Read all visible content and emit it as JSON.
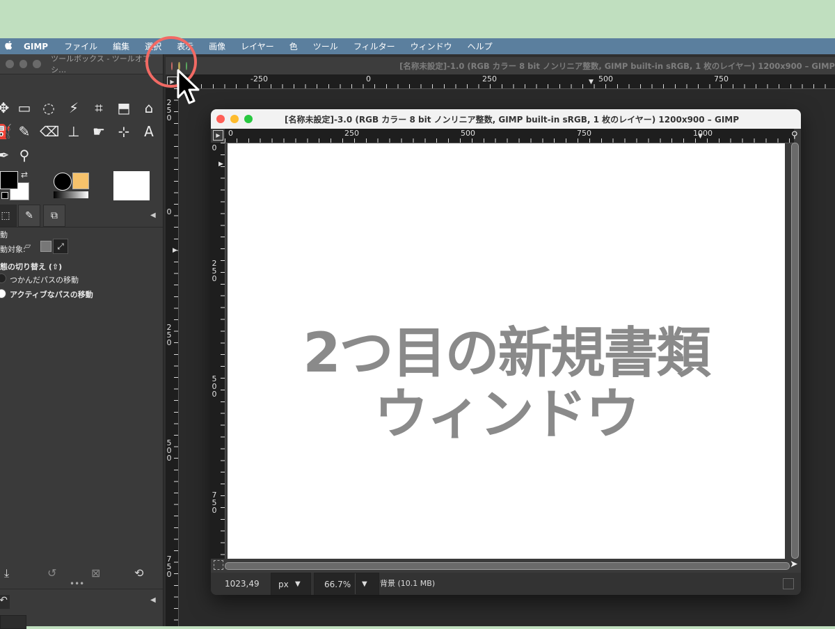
{
  "menubar": {
    "apple": "",
    "app": "GIMP",
    "items": [
      "ファイル",
      "編集",
      "選択",
      "表示",
      "画像",
      "レイヤー",
      "色",
      "ツール",
      "フィルター",
      "ウィンドウ",
      "ヘルプ"
    ]
  },
  "toolbox": {
    "title": "ツールボックス - ツールオプシ…",
    "options": {
      "heading": "動",
      "target_label": "動対象:",
      "toggle_label": "態の切り替え (⇧)",
      "radio1": "つかんだパスの移動",
      "radio2": "アクティブなパスの移動"
    }
  },
  "back_window": {
    "title": "[名称未設定]-1.0 (RGB カラー 8 bit ノンリニア整数, GIMP built-in sRGB, 1 枚のレイヤー) 1200x900 – GIMP",
    "ruler_h": [
      "-250",
      "0",
      "250",
      "500",
      "750"
    ],
    "ruler_v": [
      [
        "2",
        "5",
        "0"
      ],
      [
        "0"
      ],
      [
        "2",
        "5",
        "0"
      ],
      [
        "5",
        "0",
        "0"
      ],
      [
        "7",
        "5",
        "0"
      ]
    ]
  },
  "front_window": {
    "title": "[名称未設定]-3.0 (RGB カラー 8 bit ノンリニア整数, GIMP built-in sRGB, 1 枚のレイヤー) 1200x900 – GIMP",
    "ruler_h": [
      "0",
      "250",
      "500",
      "750",
      "1000"
    ],
    "ruler_v": [
      [
        "0"
      ],
      [
        "2",
        "5",
        "0"
      ],
      [
        "5",
        "0",
        "0"
      ],
      [
        "7",
        "5",
        "0"
      ]
    ],
    "canvas_text_line1": "2つ目の新規書類",
    "canvas_text_line2": "ウィンドウ",
    "status": {
      "coords": "1023,49",
      "unit": "px",
      "zoom": "66.7%",
      "info": "背景 (10.1 MB)"
    }
  },
  "colors": {
    "menubar": "#5b7f9e",
    "highlight_ring": "#f26a64",
    "canvas_text": "#8a8a8a",
    "desktop_green": "#c0dfbf"
  }
}
